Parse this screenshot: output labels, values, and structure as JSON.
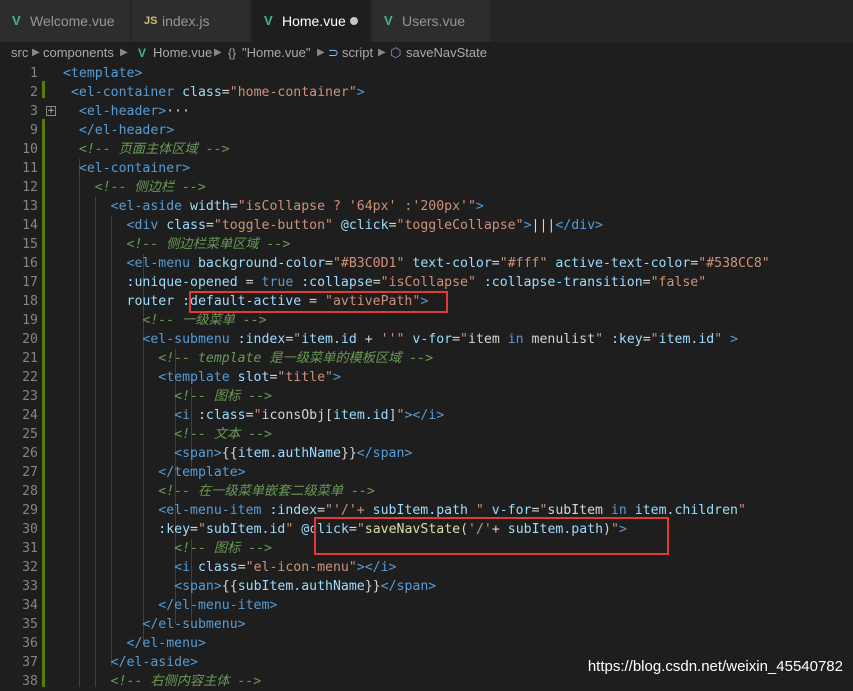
{
  "tabs": [
    {
      "label": "Welcome.vue",
      "icon": "vue-icon",
      "active": false,
      "dirty": false
    },
    {
      "label": "index.js",
      "icon": "js-icon",
      "active": false,
      "dirty": false
    },
    {
      "label": "Home.vue",
      "icon": "vue-icon",
      "active": true,
      "dirty": true
    },
    {
      "label": "Users.vue",
      "icon": "vue-icon",
      "active": false,
      "dirty": false
    }
  ],
  "icon_text": {
    "vue": "V",
    "js": "JS",
    "braces": "{}"
  },
  "breadcrumb": [
    "src",
    "components",
    "Home.vue",
    "\"Home.vue\"",
    "script",
    "saveNavState"
  ],
  "code_lines": [
    {
      "n": "1",
      "segs": [
        [
          "tg",
          "<template>"
        ]
      ]
    },
    {
      "n": "2",
      "segs": [
        [
          "tg",
          " <el-container "
        ],
        [
          "at",
          "class"
        ],
        [
          "wh",
          "="
        ],
        [
          "st",
          "\"home-container\""
        ],
        [
          "tg",
          ">"
        ]
      ]
    },
    {
      "n": "3",
      "segs": [
        [
          "tg",
          "  <el-header>"
        ],
        [
          "wh",
          "···"
        ]
      ],
      "fold": true
    },
    {
      "n": "9",
      "segs": [
        [
          "tg",
          "  </el-header>"
        ]
      ]
    },
    {
      "n": "10",
      "segs": [
        [
          "cm",
          "  <!-- 页面主体区域 -->"
        ]
      ]
    },
    {
      "n": "11",
      "segs": [
        [
          "tg",
          "  <el-container>"
        ]
      ]
    },
    {
      "n": "12",
      "segs": [
        [
          "cm",
          "    <!-- 侧边栏 -->"
        ]
      ]
    },
    {
      "n": "13",
      "segs": [
        [
          "tg",
          "      <el-aside "
        ],
        [
          "at",
          "width"
        ],
        [
          "wh",
          "="
        ],
        [
          "st",
          "\"isCollapse ? '64px' :'200px'\""
        ],
        [
          "tg",
          ">"
        ]
      ]
    },
    {
      "n": "14",
      "segs": [
        [
          "tg",
          "        <div "
        ],
        [
          "at",
          "class"
        ],
        [
          "wh",
          "="
        ],
        [
          "st",
          "\"toggle-button\" "
        ],
        [
          "at",
          "@click"
        ],
        [
          "wh",
          "="
        ],
        [
          "st",
          "\"toggleCollapse\""
        ],
        [
          "tg",
          ">"
        ],
        [
          "wh",
          "|||"
        ],
        [
          "tg",
          "</div>"
        ]
      ]
    },
    {
      "n": "15",
      "segs": [
        [
          "cm",
          "        <!-- 侧边栏菜单区域 -->"
        ]
      ]
    },
    {
      "n": "16",
      "segs": [
        [
          "tg",
          "        <el-menu "
        ],
        [
          "at",
          "background-color"
        ],
        [
          "wh",
          "="
        ],
        [
          "st",
          "\"#B3C0D1\" "
        ],
        [
          "at",
          "text-color"
        ],
        [
          "wh",
          "="
        ],
        [
          "st",
          "\"#fff\" "
        ],
        [
          "at",
          "active-text-color"
        ],
        [
          "wh",
          "="
        ],
        [
          "st",
          "\"#538CC8\""
        ]
      ]
    },
    {
      "n": "17",
      "segs": [
        [
          "at",
          "        :unique-opened "
        ],
        [
          "wh",
          "= "
        ],
        [
          "kw",
          "true "
        ],
        [
          "at",
          ":collapse"
        ],
        [
          "wh",
          "="
        ],
        [
          "st",
          "\"isCollapse\" "
        ],
        [
          "at",
          ":collapse-transition"
        ],
        [
          "wh",
          "="
        ],
        [
          "st",
          "\"false\""
        ]
      ]
    },
    {
      "n": "18",
      "segs": [
        [
          "at",
          "        router "
        ],
        [
          "at",
          ":default-active "
        ],
        [
          "wh",
          "= "
        ],
        [
          "st",
          "\"avtivePath\""
        ],
        [
          "tg",
          ">"
        ]
      ]
    },
    {
      "n": "19",
      "segs": [
        [
          "cm",
          "          <!-- 一级菜单 -->"
        ]
      ]
    },
    {
      "n": "20",
      "segs": [
        [
          "tg",
          "          <el-submenu "
        ],
        [
          "at",
          ":index"
        ],
        [
          "wh",
          "="
        ],
        [
          "st",
          "\""
        ],
        [
          "at",
          "item.id"
        ],
        [
          "wh",
          " + "
        ],
        [
          "st",
          "''\" "
        ],
        [
          "at",
          "v-for"
        ],
        [
          "wh",
          "="
        ],
        [
          "st",
          "\""
        ],
        [
          "wh",
          "item "
        ],
        [
          "kw",
          "in "
        ],
        [
          "wh",
          "menulist"
        ],
        [
          "st",
          "\" "
        ],
        [
          "at",
          ":key"
        ],
        [
          "wh",
          "="
        ],
        [
          "st",
          "\""
        ],
        [
          "at",
          "item.id"
        ],
        [
          "st",
          "\" "
        ],
        [
          "tg",
          ">"
        ]
      ]
    },
    {
      "n": "21",
      "segs": [
        [
          "cm",
          "            <!-- template 是一级菜单的模板区域 -->"
        ]
      ]
    },
    {
      "n": "22",
      "segs": [
        [
          "tg",
          "            <template "
        ],
        [
          "at",
          "slot"
        ],
        [
          "wh",
          "="
        ],
        [
          "st",
          "\"title\""
        ],
        [
          "tg",
          ">"
        ]
      ]
    },
    {
      "n": "23",
      "segs": [
        [
          "cm",
          "              <!-- 图标 -->"
        ]
      ]
    },
    {
      "n": "24",
      "segs": [
        [
          "tg",
          "              <i "
        ],
        [
          "at",
          ":class"
        ],
        [
          "wh",
          "="
        ],
        [
          "st",
          "\""
        ],
        [
          "wh",
          "iconsObj["
        ],
        [
          "at",
          "item.id"
        ],
        [
          "wh",
          "]"
        ],
        [
          "st",
          "\""
        ],
        [
          "tg",
          "></i>"
        ]
      ]
    },
    {
      "n": "25",
      "segs": [
        [
          "cm",
          "              <!-- 文本 -->"
        ]
      ]
    },
    {
      "n": "26",
      "segs": [
        [
          "tg",
          "              <span>"
        ],
        [
          "wh",
          "{{"
        ],
        [
          "at",
          "item.authName"
        ],
        [
          "wh",
          "}}"
        ],
        [
          "tg",
          "</span>"
        ]
      ]
    },
    {
      "n": "27",
      "segs": [
        [
          "tg",
          "            </template>"
        ]
      ]
    },
    {
      "n": "28",
      "segs": [
        [
          "cm",
          "            <!-- 在一级菜单嵌套二级菜单 -->"
        ]
      ]
    },
    {
      "n": "29",
      "segs": [
        [
          "tg",
          "            <el-menu-item "
        ],
        [
          "at",
          ":index"
        ],
        [
          "wh",
          "="
        ],
        [
          "st",
          "\"'/'+ "
        ],
        [
          "at",
          "subItem.path"
        ],
        [
          "st",
          " \" "
        ],
        [
          "at",
          "v-for"
        ],
        [
          "wh",
          "="
        ],
        [
          "st",
          "\""
        ],
        [
          "wh",
          "subItem "
        ],
        [
          "kw",
          "in "
        ],
        [
          "at",
          "item.children"
        ],
        [
          "st",
          "\""
        ]
      ]
    },
    {
      "n": "30",
      "segs": [
        [
          "at",
          "            :key"
        ],
        [
          "wh",
          "="
        ],
        [
          "st",
          "\""
        ],
        [
          "at",
          "subItem.id"
        ],
        [
          "st",
          "\" "
        ],
        [
          "at",
          "@click"
        ],
        [
          "wh",
          "="
        ],
        [
          "st",
          "\""
        ],
        [
          "fn",
          "saveNavState"
        ],
        [
          "wh",
          "("
        ],
        [
          "st",
          "'/'"
        ],
        [
          "wh",
          "+ "
        ],
        [
          "at",
          "subItem.path"
        ],
        [
          "wh",
          ")"
        ],
        [
          "st",
          "\""
        ],
        [
          "tg",
          ">"
        ]
      ]
    },
    {
      "n": "31",
      "segs": [
        [
          "cm",
          "              <!-- 图标 -->"
        ]
      ]
    },
    {
      "n": "32",
      "segs": [
        [
          "tg",
          "              <i "
        ],
        [
          "at",
          "class"
        ],
        [
          "wh",
          "="
        ],
        [
          "st",
          "\"el-icon-menu\""
        ],
        [
          "tg",
          "></i>"
        ]
      ]
    },
    {
      "n": "33",
      "segs": [
        [
          "tg",
          "              <span>"
        ],
        [
          "wh",
          "{{"
        ],
        [
          "at",
          "subItem.authName"
        ],
        [
          "wh",
          "}}"
        ],
        [
          "tg",
          "</span>"
        ]
      ]
    },
    {
      "n": "34",
      "segs": [
        [
          "tg",
          "            </el-menu-item>"
        ]
      ]
    },
    {
      "n": "35",
      "segs": [
        [
          "tg",
          "          </el-submenu>"
        ]
      ]
    },
    {
      "n": "36",
      "segs": [
        [
          "tg",
          "        </el-menu>"
        ]
      ]
    },
    {
      "n": "37",
      "segs": [
        [
          "tg",
          "      </el-aside>"
        ]
      ]
    },
    {
      "n": "38",
      "segs": [
        [
          "cm",
          "      <!-- 右侧内容主体 -->"
        ]
      ]
    }
  ],
  "watermark": "https://blog.csdn.net/weixin_45540782",
  "colors": {
    "highlight_box": "#e03a3a",
    "vue_green": "#41b883",
    "editor_bg": "#1e1e1e"
  }
}
